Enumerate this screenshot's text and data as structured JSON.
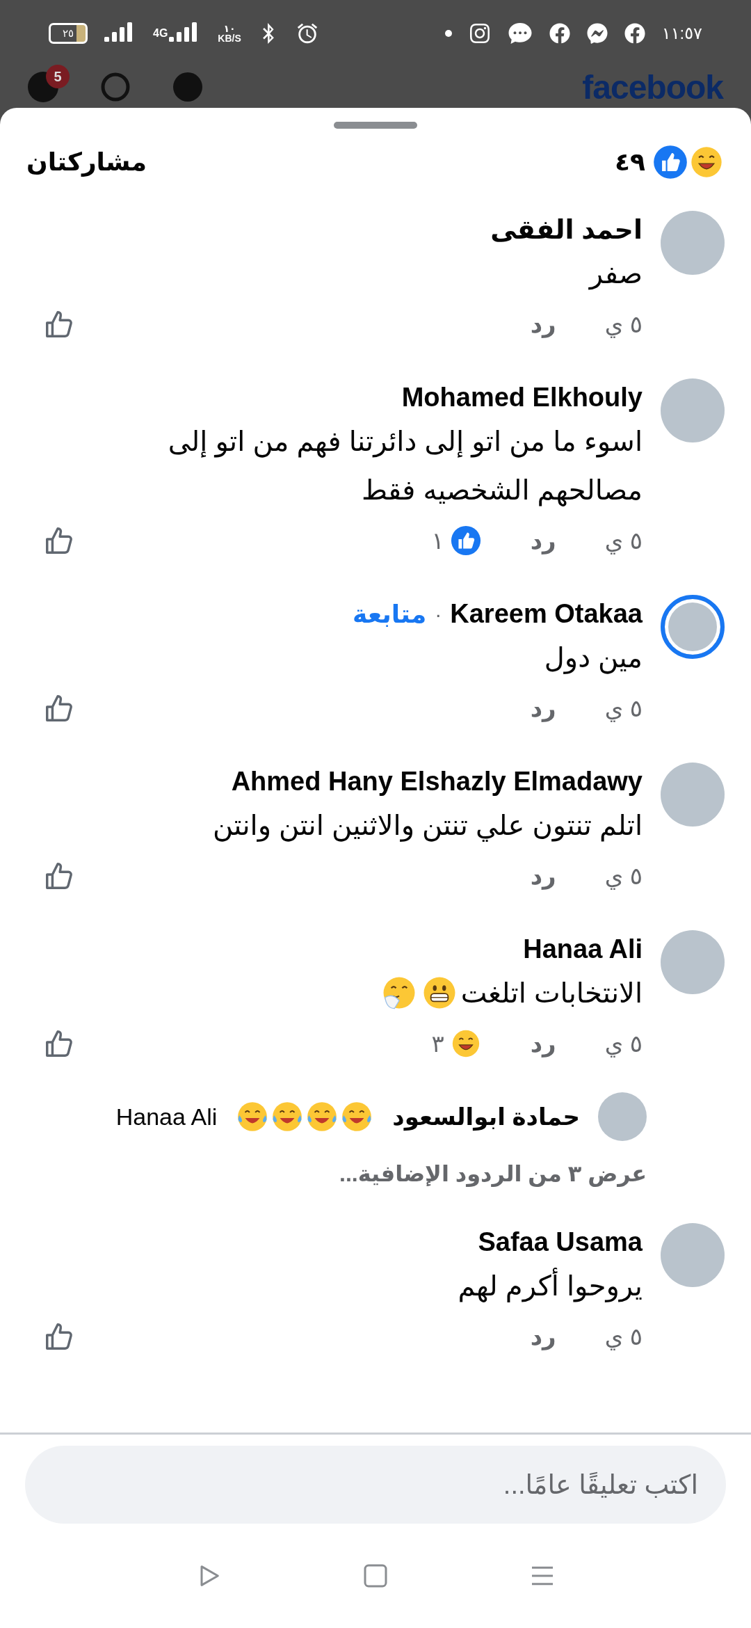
{
  "status_bar": {
    "battery": "٢٥",
    "network": "4G",
    "speed_value": "١٠",
    "speed_unit": "KB/S",
    "time": "١١:٥٧"
  },
  "app_header": {
    "logo": "facebook",
    "badge": "5"
  },
  "sheet": {
    "title": "مشاركتان",
    "reactions": [
      {
        "kind": "laugh"
      },
      {
        "kind": "like"
      }
    ],
    "reaction_count": "٤٩"
  },
  "comments": [
    {
      "author": "احمد الفقى",
      "text": "صفر",
      "time": "٥ ي",
      "reply": "رد",
      "story_ring": false
    },
    {
      "author": "Mohamed Elkhouly",
      "text": "اسوء ما من اتو إلى دائرتنا فهم من اتو إلى مصالحهم الشخصيه فقط",
      "time": "٥ ي",
      "reply": "رد",
      "story_ring": false,
      "reaction": {
        "kind": "like",
        "count": "١"
      }
    },
    {
      "author": "Kareem Otakaa",
      "separator": "·",
      "follow": "متابعة",
      "text": "مين دول",
      "time": "٥ ي",
      "reply": "رد",
      "story_ring": true
    },
    {
      "author": "Ahmed Hany Elshazly Elmadawy",
      "text": "اتلم تنتون علي تنتن والاثنين انتن وانتن",
      "time": "٥ ي",
      "reply": "رد",
      "story_ring": false
    },
    {
      "author": "Hanaa Ali",
      "text": "الانتخابات اتلغت",
      "emojis": [
        {
          "kind": "grimace"
        },
        {
          "kind": "giggle"
        }
      ],
      "time": "٥ ي",
      "reply": "رد",
      "story_ring": false,
      "reaction": {
        "kind": "laugh",
        "count": "٣"
      },
      "replies": [
        {
          "author": "حمادة ابوالسعود",
          "emojis": [
            {
              "kind": "tears-of-joy"
            },
            {
              "kind": "tears-of-joy"
            },
            {
              "kind": "tears-of-joy"
            },
            {
              "kind": "tears-of-joy"
            }
          ],
          "mention": "Hanaa Ali"
        }
      ],
      "more_replies": "عرض ٣ من الردود الإضافية..."
    },
    {
      "author": "Safaa Usama",
      "text": "يروحوا أكرم لهم",
      "time": "٥ ي",
      "reply": "رد",
      "story_ring": false
    }
  ],
  "composer": {
    "placeholder": "اكتب تعليقًا عامًا..."
  }
}
